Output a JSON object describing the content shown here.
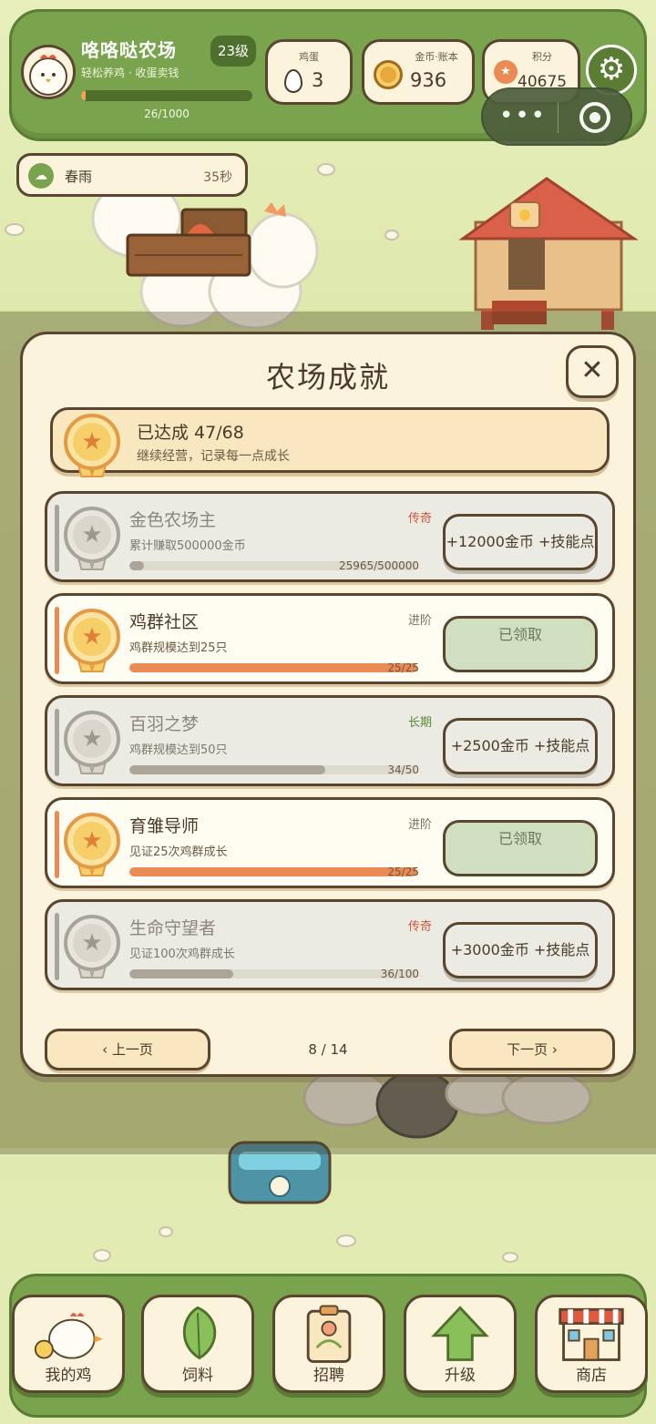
{
  "header": {
    "farm_name": "咯咯哒农场",
    "subtitle": "轻松养鸡 · 收蛋卖钱",
    "level": "23级",
    "xp_text": "26/1000",
    "xp_fraction": 0.026,
    "eggs": {
      "label": "鸡蛋",
      "value": "3"
    },
    "coins": {
      "label": "金币·账本",
      "value": "936"
    },
    "points": {
      "label": "积分",
      "value": "40675"
    }
  },
  "weather": {
    "name": "春雨",
    "time_left": "35秒",
    "icon": "cloud-rain-icon"
  },
  "modal": {
    "title": "农场成就",
    "summary": {
      "title": "已达成 47/68",
      "subtitle": "继续经营，记录每一点成长"
    },
    "achievements": [
      {
        "name": "金色农场主",
        "desc": "累计赚取500000金币",
        "tier": "传奇",
        "tier_kind": "legend",
        "progress_text": "25965/500000",
        "progress": 0.052,
        "status": "locked",
        "action": "+12000金币 +技能点"
      },
      {
        "name": "鸡群社区",
        "desc": "鸡群规模达到25只",
        "tier": "进阶",
        "tier_kind": "normal",
        "progress_text": "25/25",
        "progress": 1.0,
        "status": "done",
        "action": "已领取"
      },
      {
        "name": "百羽之梦",
        "desc": "鸡群规模达到50只",
        "tier": "长期",
        "tier_kind": "long",
        "progress_text": "34/50",
        "progress": 0.68,
        "status": "locked",
        "action": "+2500金币 +技能点"
      },
      {
        "name": "育雏导师",
        "desc": "见证25次鸡群成长",
        "tier": "进阶",
        "tier_kind": "normal",
        "progress_text": "25/25",
        "progress": 1.0,
        "status": "done",
        "action": "已领取"
      },
      {
        "name": "生命守望者",
        "desc": "见证100次鸡群成长",
        "tier": "传奇",
        "tier_kind": "legend",
        "progress_text": "36/100",
        "progress": 0.36,
        "status": "locked",
        "action": "+3000金币 +技能点"
      }
    ],
    "pager": {
      "prev": "‹ 上一页",
      "next": "下一页 ›",
      "page": "8 / 14"
    }
  },
  "nav": [
    {
      "label": "我的鸡",
      "icon": "chicken-icon"
    },
    {
      "label": "饲料",
      "icon": "leaf-icon"
    },
    {
      "label": "招聘",
      "icon": "id-badge-icon"
    },
    {
      "label": "升级",
      "icon": "up-arrow-icon"
    },
    {
      "label": "商店",
      "icon": "shop-icon"
    }
  ],
  "colors": {
    "green": "#7aa34d",
    "cream": "#fbf3dc",
    "outline": "#5a4630",
    "accent": "#ea8a55",
    "legend": "#d0573a"
  }
}
